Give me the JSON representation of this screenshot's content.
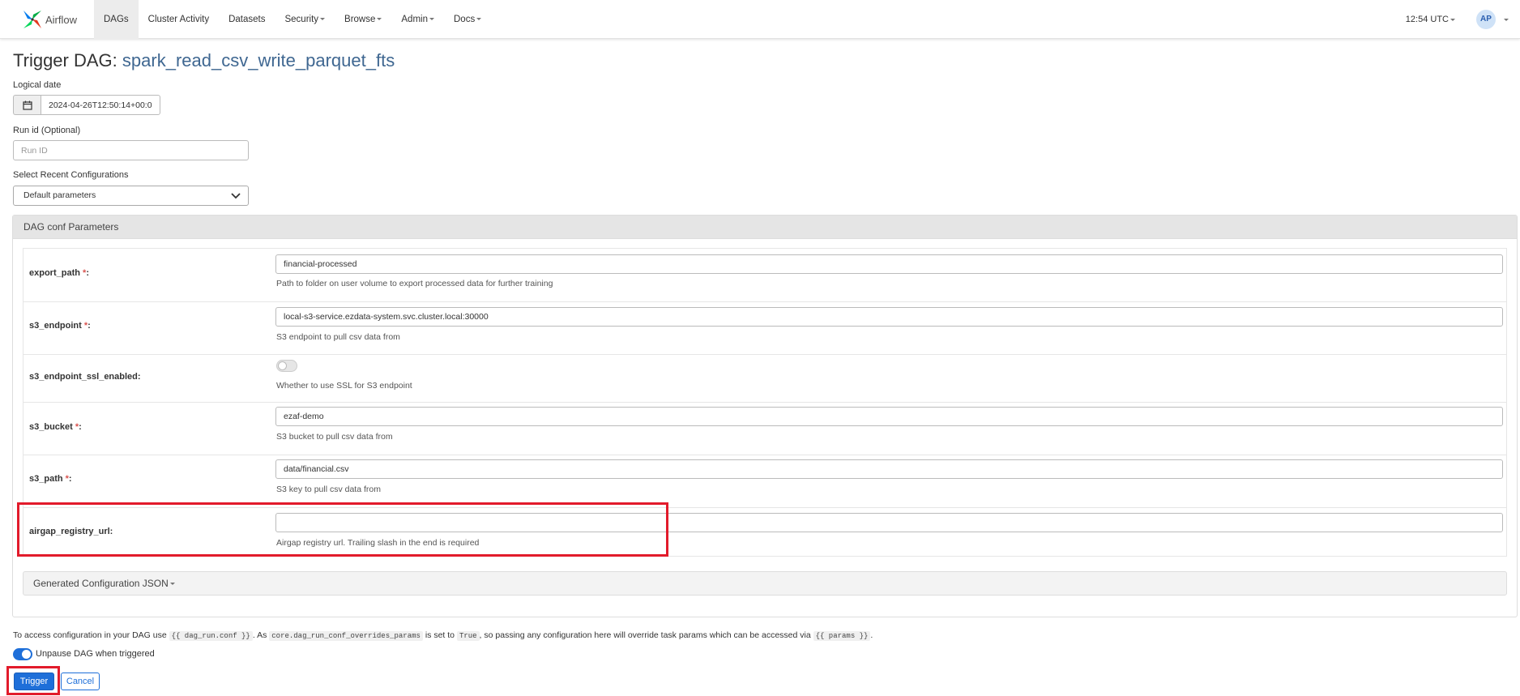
{
  "navbar": {
    "brand": "Airflow",
    "items": [
      {
        "label": "DAGs",
        "active": true,
        "dropdown": false
      },
      {
        "label": "Cluster Activity",
        "active": false,
        "dropdown": false
      },
      {
        "label": "Datasets",
        "active": false,
        "dropdown": false
      },
      {
        "label": "Security",
        "active": false,
        "dropdown": true
      },
      {
        "label": "Browse",
        "active": false,
        "dropdown": true
      },
      {
        "label": "Admin",
        "active": false,
        "dropdown": true
      },
      {
        "label": "Docs",
        "active": false,
        "dropdown": true
      }
    ],
    "clock": "12:54 UTC",
    "avatar": "AP"
  },
  "page": {
    "title_prefix": "Trigger DAG:",
    "dag_name": "spark_read_csv_write_parquet_fts"
  },
  "form": {
    "logical_date_label": "Logical date",
    "logical_date_value": "2024-04-26T12:50:14+00:0",
    "run_id_label": "Run id (Optional)",
    "run_id_placeholder": "Run ID",
    "recent_config_label": "Select Recent Configurations",
    "recent_config_value": "Default parameters"
  },
  "conf_panel": {
    "heading": "DAG conf Parameters",
    "params": [
      {
        "name": "export_path",
        "required": true,
        "type": "text",
        "value": "financial-processed",
        "help": "Path to folder on user volume to export processed data for further training"
      },
      {
        "name": "s3_endpoint",
        "required": true,
        "type": "text",
        "value": "local-s3-service.ezdata-system.svc.cluster.local:30000",
        "help": "S3 endpoint to pull csv data from"
      },
      {
        "name": "s3_endpoint_ssl_enabled",
        "required": false,
        "type": "toggle",
        "value": false,
        "help": "Whether to use SSL for S3 endpoint"
      },
      {
        "name": "s3_bucket",
        "required": true,
        "type": "text",
        "value": "ezaf-demo",
        "help": "S3 bucket to pull csv data from"
      },
      {
        "name": "s3_path",
        "required": true,
        "type": "text",
        "value": "data/financial.csv",
        "help": "S3 key to pull csv data from"
      },
      {
        "name": "airgap_registry_url",
        "required": false,
        "type": "text",
        "value": "",
        "help": "Airgap registry url. Trailing slash in the end is required"
      }
    ],
    "generated_json_label": "Generated Configuration JSON"
  },
  "info": {
    "t1": "To access configuration in your DAG use",
    "c1": "{{ dag_run.conf }}",
    "t2": ". As",
    "c2": "core.dag_run_conf_overrides_params",
    "t3": "is set to",
    "c3": "True",
    "t4": ", so passing any configuration here will override task params which can be accessed via",
    "c4": "{{ params }}",
    "t5": "."
  },
  "unpause": {
    "label": "Unpause DAG when triggered",
    "checked": true
  },
  "buttons": {
    "trigger": "Trigger",
    "cancel": "Cancel"
  },
  "colors": {
    "accent": "#1e6fd9",
    "highlight": "#e21b2b",
    "dag_name": "#3f6791"
  }
}
